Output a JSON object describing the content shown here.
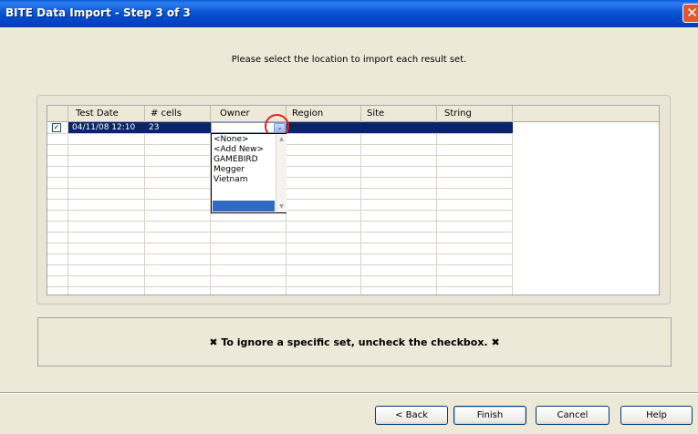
{
  "window": {
    "title": "BITE Data Import - Step 3 of 3",
    "close_glyph": "✕"
  },
  "instruction": "Please select the location to import each result set.",
  "grid": {
    "columns": [
      "Test Date",
      "# cells",
      "Owner",
      "Region",
      "Site",
      "String"
    ],
    "rows": [
      {
        "checked": true,
        "check_glyph": "✓",
        "test_date": "04/11/08 12:10",
        "cells": "23",
        "owner": "",
        "region": "",
        "site": "",
        "string": ""
      }
    ]
  },
  "owner_dropdown": {
    "open": true,
    "button_glyph": "⌄",
    "options": [
      "<None>",
      "<Add New>",
      "GAMEBIRD",
      "Megger",
      "Vietnam",
      ""
    ],
    "highlighted_index": 5,
    "scroll_up_glyph": "▲",
    "scroll_down_glyph": "▼"
  },
  "info": {
    "text": "✖ To ignore a specific set, uncheck the checkbox. ✖"
  },
  "buttons": {
    "back": "< Back",
    "finish": "Finish",
    "cancel": "Cancel",
    "help": "Help"
  },
  "colors": {
    "title_bar": "#0a55d4",
    "selected_row": "#0a246a",
    "highlight": "#316ac5",
    "annotation_circle": "#e02020",
    "close_button": "#e2572e"
  }
}
